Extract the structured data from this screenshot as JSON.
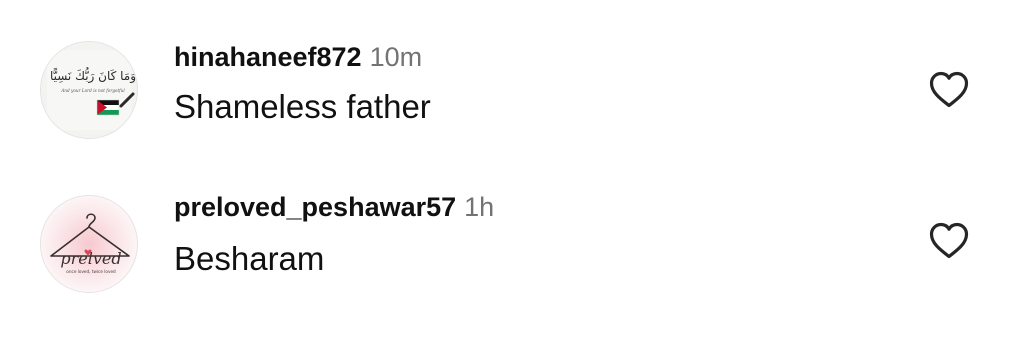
{
  "comments": [
    {
      "username": "hinahaneef872",
      "time": "10m",
      "text": "Shameless father",
      "avatar": {
        "calligraphy": "وَمَا كَانَ رَبُّكَ نَسِيًّا",
        "caption": "And your Lord is not forgetful",
        "flag": "palestine-flag"
      },
      "like_icon": "heart-outline-icon"
    },
    {
      "username": "preloved_peshawar57",
      "time": "1h",
      "text": "Besharam",
      "avatar": {
        "logo_text": "prelved",
        "tagline": "once loved, twice loved",
        "accent": "#d9465a"
      },
      "like_icon": "heart-outline-icon"
    }
  ],
  "colors": {
    "username": "#111111",
    "timestamp": "#737373",
    "icon_stroke": "#262626",
    "flag_red": "#c8102e",
    "flag_green": "#149954"
  }
}
